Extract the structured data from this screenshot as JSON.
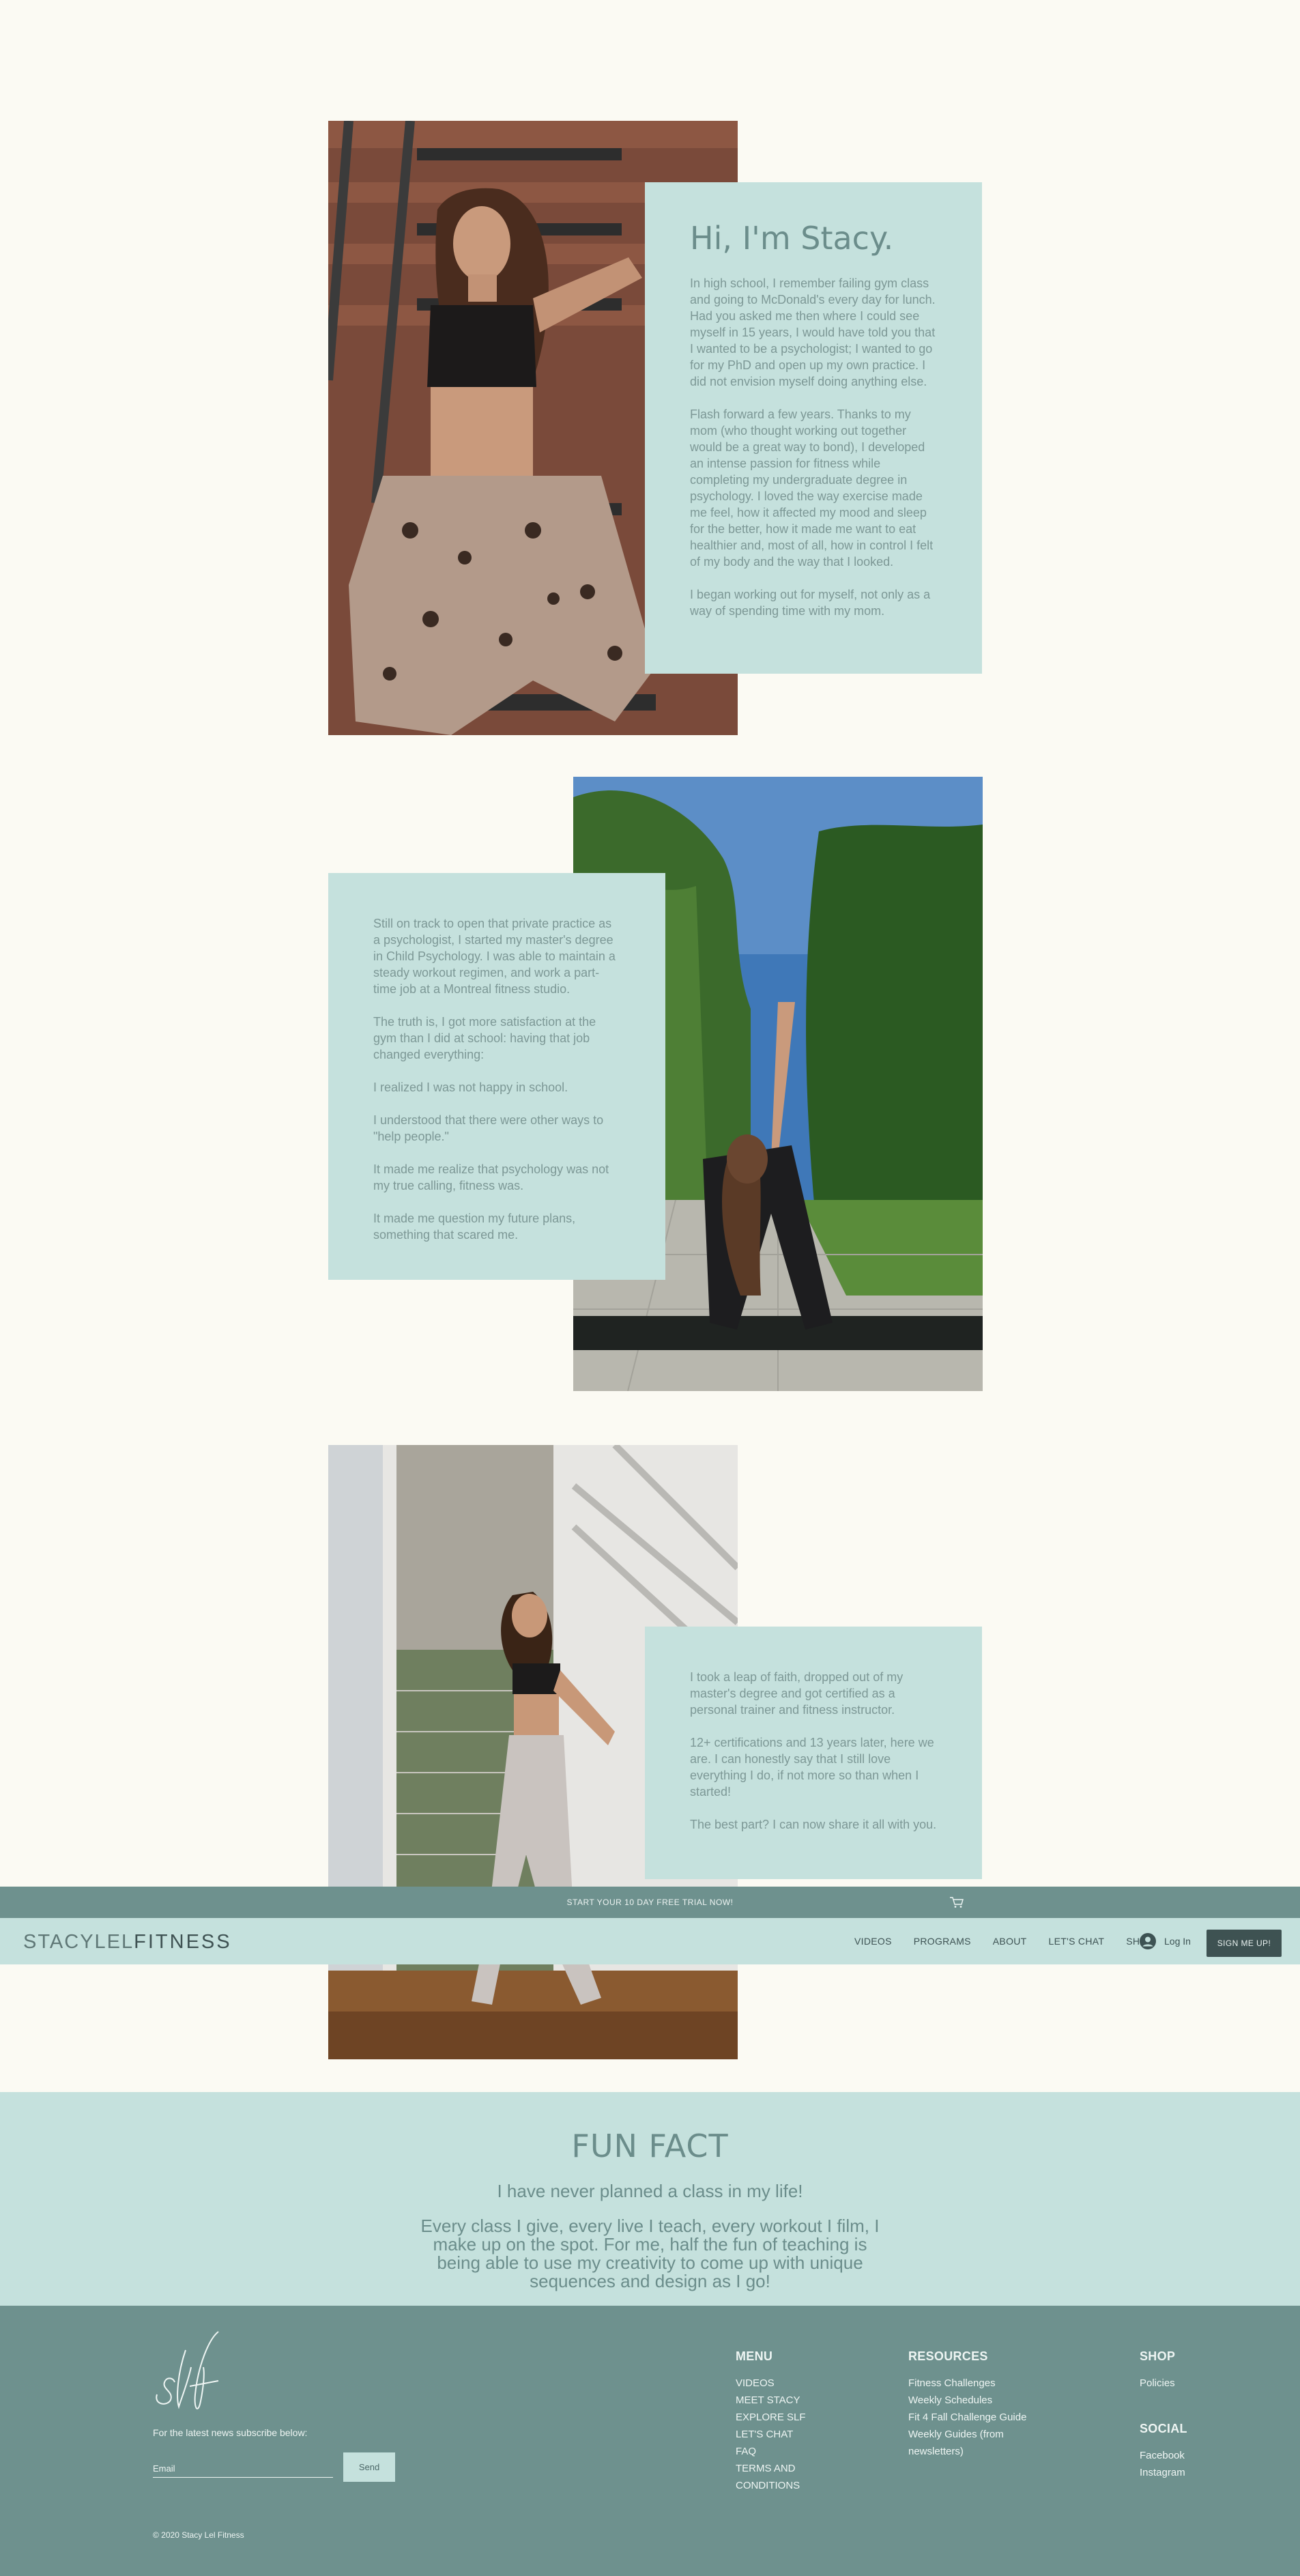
{
  "about": {
    "title": "Hi, I'm Stacy.",
    "block1": [
      "In high school, I remember failing gym class and going to McDonald's every day for lunch. Had you asked me then where I could see myself in 15 years, I would have told you that I wanted to be a psychologist; I wanted to go for my PhD and open up my own practice. I did not envision myself doing anything else.",
      "Flash forward a few years. Thanks to my mom (who thought working out together would be a great way to bond), I developed an intense passion for fitness while completing my undergraduate degree in psychology. I loved the way exercise made me feel, how it affected my mood and sleep for the better, how it made me want to eat healthier and, most of all, how in control I felt of my body and the way that I looked.",
      "I began working out for myself, not only as a way of spending time with my mom."
    ],
    "block2": [
      "Still on track to open that private practice as a psychologist, I started my master's degree in Child Psychology. I was able to maintain a steady workout regimen, and work a part-time job at a Montreal fitness studio.",
      "The truth is, I got more satisfaction at the gym than I did at school: having that job changed everything:",
      "I realized I was not happy in school.",
      "I understood that there were other ways to \"help people.\"",
      "It made me realize that psychology was not my true calling, fitness was.",
      "It made me question my future plans, something that scared me."
    ],
    "block3": [
      "I took a leap of faith, dropped out of my master's degree and got certified as a personal trainer and fitness instructor.",
      "12+ certifications and 13 years later, here we are. I can honestly say that I still love everything I do, if not more so than when I started!",
      "The best part? I can now share it all with you."
    ]
  },
  "header": {
    "promo": "START YOUR 10 DAY FREE TRIAL NOW!",
    "cart_icon": "cart-icon",
    "logo_light": "STACYLEL",
    "logo_bold": "FITNESS",
    "nav": [
      "VIDEOS",
      "PROGRAMS",
      "ABOUT",
      "LET'S CHAT",
      "SHOP"
    ],
    "login": "Log In",
    "signup": "SIGN ME UP!"
  },
  "funfact": {
    "title": "FUN FACT",
    "subtitle": "I have never planned a class in my life!",
    "body": "Every class I give, every live I teach, every workout I film, I make up on the spot. For me, half the fun of teaching is being able to use my creativity to come up with unique sequences and design as I go!"
  },
  "footer": {
    "signature": "slf",
    "newsletter": "For the latest news subscribe below:",
    "email_placeholder": "Email",
    "send": "Send",
    "copyright": "© 2020 Stacy Lel Fitness",
    "menu": {
      "title": "MENU",
      "items": [
        "VIDEOS",
        "MEET STACY",
        "EXPLORE SLF",
        "LET'S CHAT",
        "FAQ",
        "TERMS AND CONDITIONS"
      ]
    },
    "resources": {
      "title": "RESOURCES",
      "items": [
        "Fitness Challenges",
        "Weekly Schedules",
        "Fit 4 Fall Challenge Guide",
        "Weekly Guides (from newsletters)"
      ]
    },
    "shop": {
      "title": "SHOP",
      "items": [
        "Policies"
      ]
    },
    "social": {
      "title": "SOCIAL",
      "items": [
        "Facebook",
        "Instagram"
      ]
    }
  },
  "colors": {
    "background": "#fbfaf3",
    "mint": "#c5e1dd",
    "teal": "#6e918e",
    "dark": "#3e5252"
  }
}
